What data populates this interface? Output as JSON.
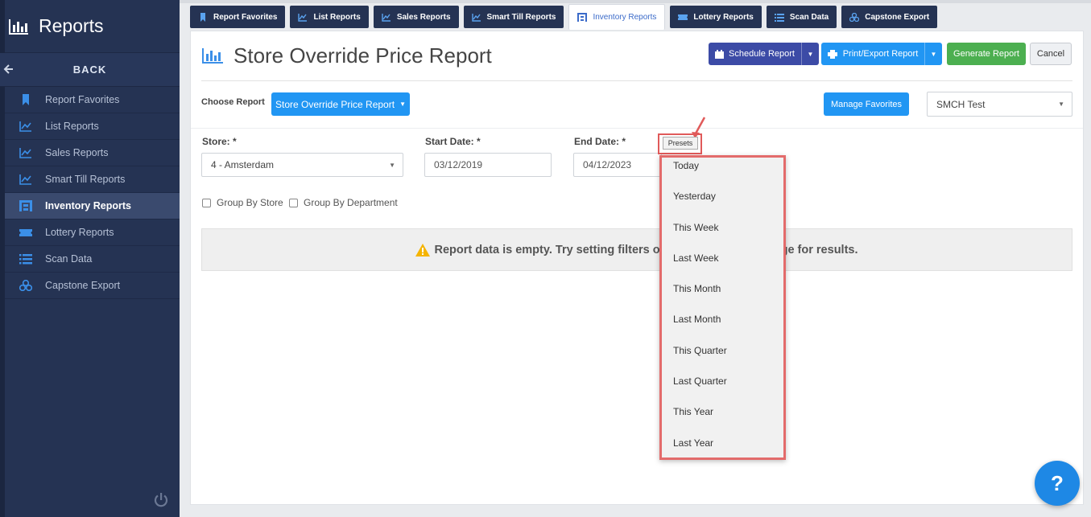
{
  "sidebar": {
    "title": "Reports",
    "back_label": "BACK",
    "items": [
      {
        "label": "Report Favorites",
        "icon": "bookmark-icon"
      },
      {
        "label": "List Reports",
        "icon": "line-chart-icon"
      },
      {
        "label": "Sales Reports",
        "icon": "line-chart-icon"
      },
      {
        "label": "Smart Till Reports",
        "icon": "line-chart-icon"
      },
      {
        "label": "Inventory Reports",
        "icon": "warehouse-icon",
        "active": true
      },
      {
        "label": "Lottery Reports",
        "icon": "ticket-icon"
      },
      {
        "label": "Scan Data",
        "icon": "list-icon"
      },
      {
        "label": "Capstone Export",
        "icon": "cubes-icon"
      }
    ]
  },
  "tabs": [
    {
      "label": "Report Favorites"
    },
    {
      "label": "List Reports"
    },
    {
      "label": "Sales Reports"
    },
    {
      "label": "Smart Till Reports"
    },
    {
      "label": "Inventory Reports",
      "active": true
    },
    {
      "label": "Lottery Reports"
    },
    {
      "label": "Scan Data"
    },
    {
      "label": "Capstone Export"
    }
  ],
  "header": {
    "title": "Store Override Price Report",
    "schedule_label": "Schedule Report",
    "print_label": "Print/Export Report",
    "generate_label": "Generate Report",
    "cancel_label": "Cancel"
  },
  "report_select": {
    "label": "Choose Report",
    "value": "Store Override Price Report",
    "manage_favorites": "Manage Favorites",
    "company_value": "SMCH Test"
  },
  "filters": {
    "store_label": "Store: *",
    "store_value": "4 - Amsterdam",
    "start_label": "Start Date: *",
    "start_value": "03/12/2019",
    "end_label": "End Date: *",
    "end_value": "04/12/2023",
    "presets_label": "Presets",
    "group_by_store": "Group By Store",
    "group_by_department": "Group By Department"
  },
  "presets_menu": [
    "Today",
    "Yesterday",
    "This Week",
    "Last Week",
    "This Month",
    "Last Month",
    "This Quarter",
    "Last Quarter",
    "This Year",
    "Last Year"
  ],
  "alert": {
    "left_text": "Report data is empty. Try setting filters o",
    "right_text": "ge for results."
  },
  "help_label": "?",
  "colors": {
    "sidebar_bg": "#253353",
    "primary_blue": "#2196f3",
    "navy_button": "#3c4ba6",
    "green_button": "#4caf50",
    "highlight_red": "#e36b6b"
  }
}
